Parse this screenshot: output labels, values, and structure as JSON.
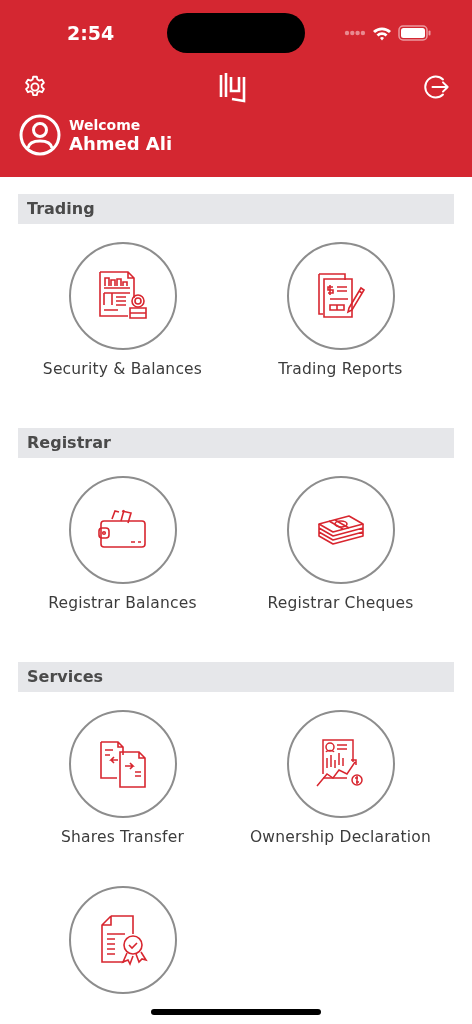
{
  "status_bar": {
    "time": "2:54"
  },
  "header": {
    "greeting": "Welcome",
    "user_name": "Ahmed Ali"
  },
  "sections": [
    {
      "title": "Trading",
      "tiles": [
        {
          "kind": "report",
          "label": "Security & Balances"
        },
        {
          "kind": "invoice",
          "label": "Trading Reports"
        }
      ]
    },
    {
      "title": "Registrar",
      "tiles": [
        {
          "kind": "wallet",
          "label": "Registrar Balances"
        },
        {
          "kind": "cash",
          "label": "Registrar Cheques"
        }
      ]
    },
    {
      "title": "Services",
      "tiles": [
        {
          "kind": "transfer",
          "label": "Shares Transfer"
        },
        {
          "kind": "chart",
          "label": "Ownership Declaration"
        },
        {
          "kind": "certificate"
        }
      ]
    }
  ]
}
